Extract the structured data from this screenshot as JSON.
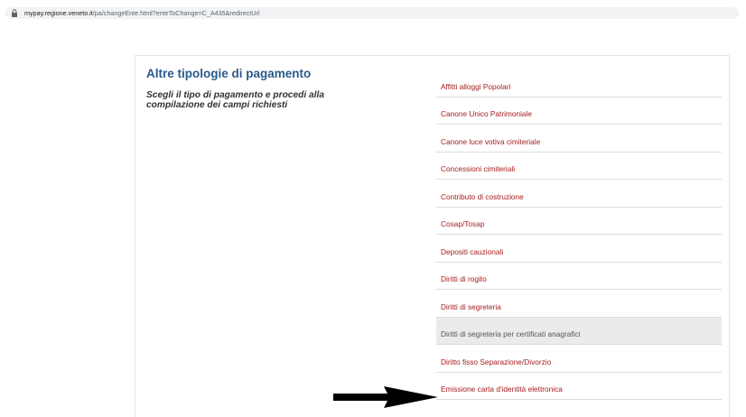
{
  "browser": {
    "url_host": "mypay.regione.veneto.it",
    "url_path": "/pa/changeEnte.html?enteToChange=C_A435&redirectUrl"
  },
  "panel": {
    "title": "Altre tipologie di pagamento",
    "subtitle": "Scegli il tipo di pagamento e procedi alla compilazione dei campi richiesti"
  },
  "payment_types": [
    {
      "label": "Affitti alloggi Popolari"
    },
    {
      "label": "Canone Unico Patrimoniale"
    },
    {
      "label": "Canone luce votiva cimiteriale"
    },
    {
      "label": "Concessioni cimiteriali"
    },
    {
      "label": "Contributo di costruzione"
    },
    {
      "label": "Cosap/Tosap"
    },
    {
      "label": "Depositi cauzionali"
    },
    {
      "label": "Diritti di rogito"
    },
    {
      "label": "Diritti di segreteria"
    },
    {
      "label": "Diritti di segreteria per certificati anagrafici"
    },
    {
      "label": "Diritto fisso Separazione/Divorzio"
    },
    {
      "label": "Emissione carta d'identità elettronica"
    }
  ],
  "colors": {
    "title": "#2a5a8a",
    "link": "#a51d1d",
    "selected_row_bg": "#ebebeb"
  }
}
